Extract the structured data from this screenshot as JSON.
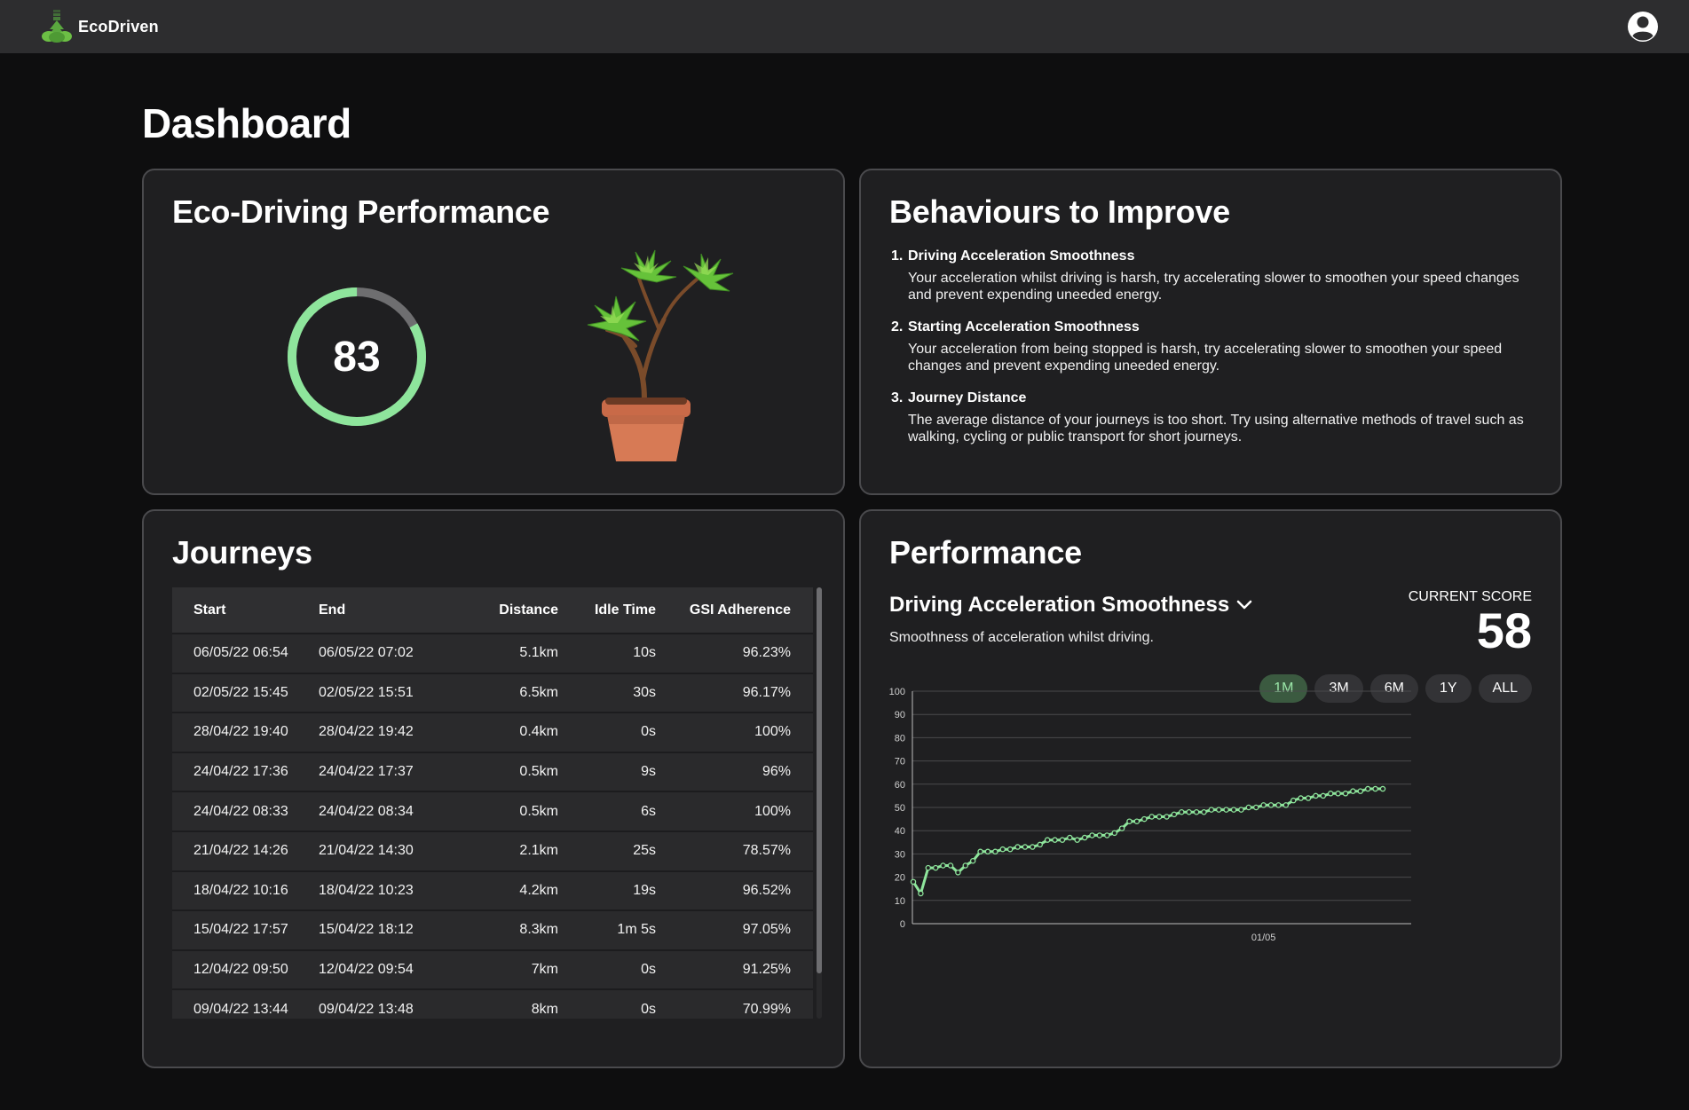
{
  "app": {
    "name": "EcoDriven",
    "logo_icon": "tree-logo-icon",
    "account_icon": "account-circle-icon",
    "accent": "#8ee59c"
  },
  "page": {
    "title": "Dashboard"
  },
  "eco_card": {
    "title": "Eco-Driving Performance",
    "score": "83",
    "score_fraction": 0.83,
    "ring_color": "#8ee59c",
    "image": "potted-plant-image"
  },
  "behaviours": {
    "title": "Behaviours to Improve",
    "items": [
      {
        "number": "1.",
        "title": "Driving Acceleration Smoothness",
        "text": "Your acceleration whilst driving is harsh, try accelerating slower to smoothen your speed changes and prevent expending uneeded energy."
      },
      {
        "number": "2.",
        "title": "Starting Acceleration Smoothness",
        "text": "Your acceleration from being stopped is harsh, try accelerating slower to smoothen your speed changes and prevent expending uneeded energy."
      },
      {
        "number": "3.",
        "title": "Journey Distance",
        "text": "The average distance of your journeys is too short. Try using alternative methods of travel such as walking, cycling or public transport for short journeys."
      }
    ]
  },
  "journeys": {
    "title": "Journeys",
    "columns": [
      "Start",
      "End",
      "Distance",
      "Idle Time",
      "GSI Adherence"
    ],
    "rows": [
      [
        "06/05/22 06:54",
        "06/05/22 07:02",
        "5.1km",
        "10s",
        "96.23%"
      ],
      [
        "02/05/22 15:45",
        "02/05/22 15:51",
        "6.5km",
        "30s",
        "96.17%"
      ],
      [
        "28/04/22 19:40",
        "28/04/22 19:42",
        "0.4km",
        "0s",
        "100%"
      ],
      [
        "24/04/22 17:36",
        "24/04/22 17:37",
        "0.5km",
        "9s",
        "96%"
      ],
      [
        "24/04/22 08:33",
        "24/04/22 08:34",
        "0.5km",
        "6s",
        "100%"
      ],
      [
        "21/04/22 14:26",
        "21/04/22 14:30",
        "2.1km",
        "25s",
        "78.57%"
      ],
      [
        "18/04/22 10:16",
        "18/04/22 10:23",
        "4.2km",
        "19s",
        "96.52%"
      ],
      [
        "15/04/22 17:57",
        "15/04/22 18:12",
        "8.3km",
        "1m 5s",
        "97.05%"
      ],
      [
        "12/04/22 09:50",
        "12/04/22 09:54",
        "7km",
        "0s",
        "91.25%"
      ],
      [
        "09/04/22 13:44",
        "09/04/22 13:48",
        "8km",
        "0s",
        "70.99%"
      ]
    ]
  },
  "performance": {
    "title": "Performance",
    "metric": "Driving Acceleration Smoothness",
    "metric_icon": "chevron-down-icon",
    "description": "Smoothness of acceleration whilst driving.",
    "score_label": "CURRENT SCORE",
    "score": "58",
    "ranges": [
      "1M",
      "3M",
      "6M",
      "1Y",
      "ALL"
    ],
    "active_range": "1M"
  },
  "chart_data": {
    "type": "line",
    "ylim": [
      0,
      100
    ],
    "yticks": [
      0,
      10,
      20,
      30,
      40,
      50,
      60,
      70,
      80,
      90,
      100
    ],
    "x_tick_labels": [
      {
        "label": "01/05",
        "index": 47
      }
    ],
    "grid": true,
    "color": "#8ee59c",
    "series": [
      {
        "values": [
          18,
          13,
          24,
          24,
          25,
          25,
          22,
          25,
          27,
          31,
          31,
          31,
          32,
          32,
          33,
          33,
          33,
          34,
          36,
          36,
          36,
          37,
          36,
          37,
          38,
          38,
          38,
          39,
          41,
          44,
          44,
          45,
          46,
          46,
          46,
          47,
          48,
          48,
          48,
          48,
          49,
          49,
          49,
          49,
          49,
          50,
          50,
          51,
          51,
          51,
          51,
          53,
          54,
          54,
          55,
          55,
          56,
          56,
          56,
          57,
          57,
          58,
          58,
          58
        ]
      }
    ]
  }
}
